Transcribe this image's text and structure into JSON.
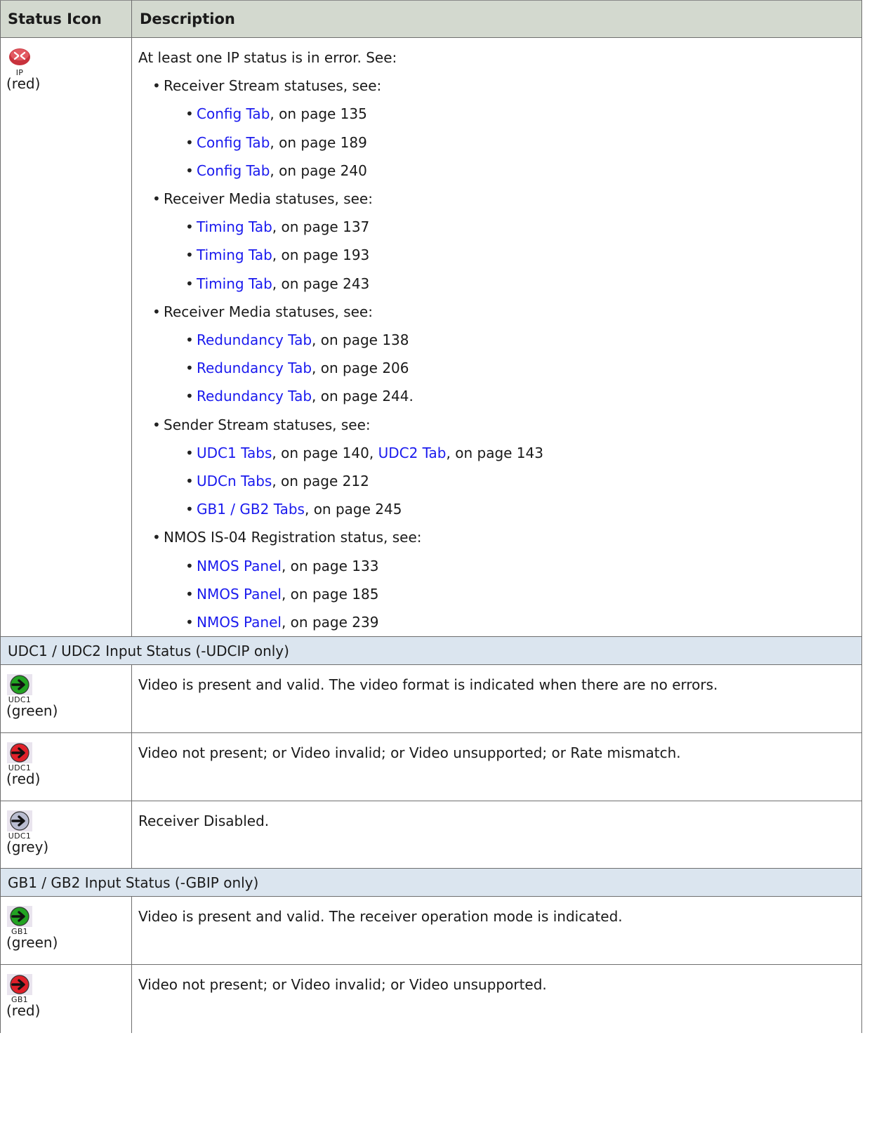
{
  "table": {
    "headers": [
      "Status Icon",
      "Description"
    ]
  },
  "ip_row": {
    "icon_name": "ip-red-router-icon",
    "icon_caption": "IP",
    "color_note": "(red)",
    "intro": "At least one IP status is in error. See:",
    "groups": [
      {
        "label": "Receiver Stream statuses, see:",
        "refs": [
          {
            "link": "Config Tab",
            "suffix": ", on page 135"
          },
          {
            "link": "Config Tab",
            "suffix": ", on page 189"
          },
          {
            "link": "Config Tab",
            "suffix": ", on page 240"
          }
        ]
      },
      {
        "label": "Receiver Media statuses, see:",
        "refs": [
          {
            "link": "Timing Tab",
            "suffix": ", on page 137"
          },
          {
            "link": "Timing Tab",
            "suffix": ", on page 193"
          },
          {
            "link": "Timing Tab",
            "suffix": ", on page 243"
          }
        ]
      },
      {
        "label": "Receiver Media statuses, see:",
        "refs": [
          {
            "link": "Redundancy Tab",
            "suffix": ", on page 138"
          },
          {
            "link": "Redundancy Tab",
            "suffix": ", on page 206"
          },
          {
            "link": "Redundancy Tab",
            "suffix": ", on page 244."
          }
        ]
      },
      {
        "label": "Sender Stream statuses, see:",
        "refs": [
          {
            "link": "UDC1 Tabs",
            "suffix": ", on page 140, ",
            "link2": "UDC2 Tab",
            "suffix2": ", on page 143"
          },
          {
            "link": "UDCn Tabs",
            "suffix": ", on page 212"
          },
          {
            "link": "GB1 / GB2 Tabs",
            "suffix": ", on page 245"
          }
        ]
      },
      {
        "label": "NMOS IS-04 Registration status, see:",
        "refs": [
          {
            "link": "NMOS Panel",
            "suffix": ", on page 133"
          },
          {
            "link": "NMOS Panel",
            "suffix": ", on page 185"
          },
          {
            "link": "NMOS Panel",
            "suffix": ", on page 239"
          }
        ]
      }
    ]
  },
  "sections": [
    {
      "title": "UDC1 / UDC2 Input Status (-UDCIP only)",
      "rows": [
        {
          "icon_name": "udc1-green-arrow-icon",
          "icon_caption": "UDC1",
          "color": "#22a322",
          "color_note": "(green)",
          "description": "Video is present and valid. The video format is indicated when there are no errors."
        },
        {
          "icon_name": "udc1-red-arrow-icon",
          "icon_caption": "UDC1",
          "color": "#e0202a",
          "color_note": "(red)",
          "description": "Video not present; or Video invalid; or Video unsupported; or Rate mismatch."
        },
        {
          "icon_name": "udc1-grey-arrow-icon",
          "icon_caption": "UDC1",
          "color": "#b9bcd0",
          "color_note": "(grey)",
          "description": "Receiver Disabled."
        }
      ]
    },
    {
      "title": "GB1 / GB2 Input Status (-GBIP only)",
      "rows": [
        {
          "icon_name": "gb1-green-arrow-icon",
          "icon_caption": "GB1",
          "color": "#22a322",
          "color_note": "(green)",
          "description": "Video is present and valid. The receiver operation mode is indicated."
        },
        {
          "icon_name": "gb1-red-arrow-icon",
          "icon_caption": "GB1",
          "color": "#e0202a",
          "color_note": "(red)",
          "description": "Video not present; or Video invalid; or Video unsupported."
        }
      ]
    }
  ],
  "colors": {
    "header_bg": "#d3d9cf",
    "section_bg": "#dbe5ef",
    "link": "#1a1aee"
  }
}
